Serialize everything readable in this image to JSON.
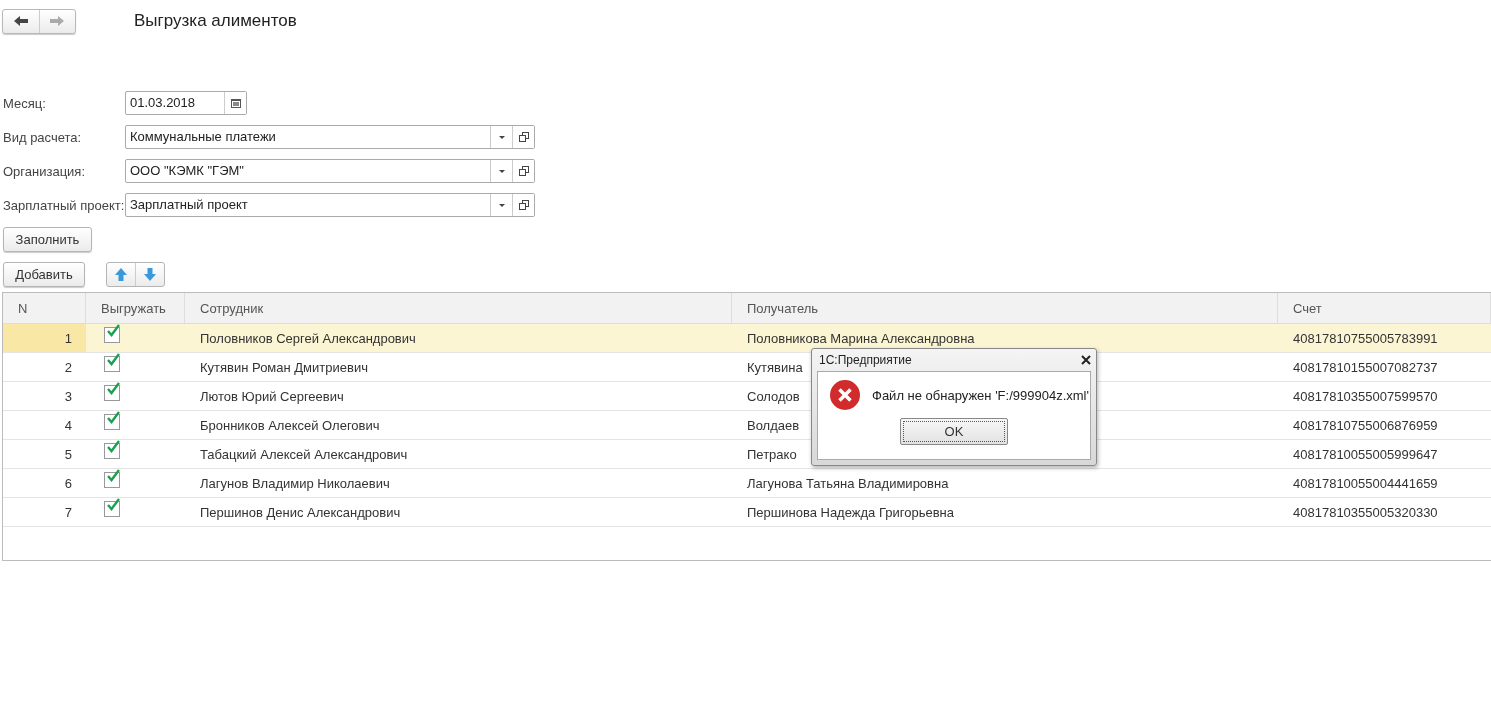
{
  "title": "Выгрузка алиментов",
  "form": [
    {
      "label": "Месяц:",
      "value": "01.03.2018",
      "kind": "date"
    },
    {
      "label": "Вид расчета:",
      "value": "Коммунальные платежи",
      "kind": "select"
    },
    {
      "label": "Организация:",
      "value": "ООО \"КЭМК \"ГЭМ\"",
      "kind": "select"
    },
    {
      "label": "Зарплатный проект:",
      "value": "Зарплатный проект",
      "kind": "select"
    }
  ],
  "fill_button": "Заполнить",
  "add_button": "Добавить",
  "table": {
    "columns": [
      "N",
      "Выгружать",
      "Сотрудник",
      "Получатель",
      "Счет"
    ],
    "rows": [
      {
        "n": "1",
        "checked": true,
        "employee": "Половников Сергей Александрович",
        "recipient": "Половникова Марина Александровна",
        "account": "40817810755005783991",
        "selected": true
      },
      {
        "n": "2",
        "checked": true,
        "employee": "Кутявин Роман Дмитриевич",
        "recipient": "Кутявина",
        "account": "40817810155007082737",
        "selected": false
      },
      {
        "n": "3",
        "checked": true,
        "employee": "Лютов Юрий Сергеевич",
        "recipient": "Солодов",
        "account": "40817810355007599570",
        "selected": false
      },
      {
        "n": "4",
        "checked": true,
        "employee": "Бронников Алексей Олегович",
        "recipient": "Волдаев",
        "account": "40817810755006876959",
        "selected": false
      },
      {
        "n": "5",
        "checked": true,
        "employee": "Табацкий Алексей Александрович",
        "recipient": "Петрако",
        "account": "40817810055005999647",
        "selected": false
      },
      {
        "n": "6",
        "checked": true,
        "employee": "Лагунов Владимир Николаевич",
        "recipient": "Лагунова Татьяна Владимировна",
        "account": "40817810055004441659",
        "selected": false
      },
      {
        "n": "7",
        "checked": true,
        "employee": "Першинов Денис Александрович",
        "recipient": "Першинова Надежда Григорьевна",
        "account": "40817810355005320330",
        "selected": false
      }
    ]
  },
  "dialog": {
    "title": "1С:Предприятие",
    "message": "Файл не обнаружен 'F:/999904z.xml'",
    "ok": "OK"
  }
}
